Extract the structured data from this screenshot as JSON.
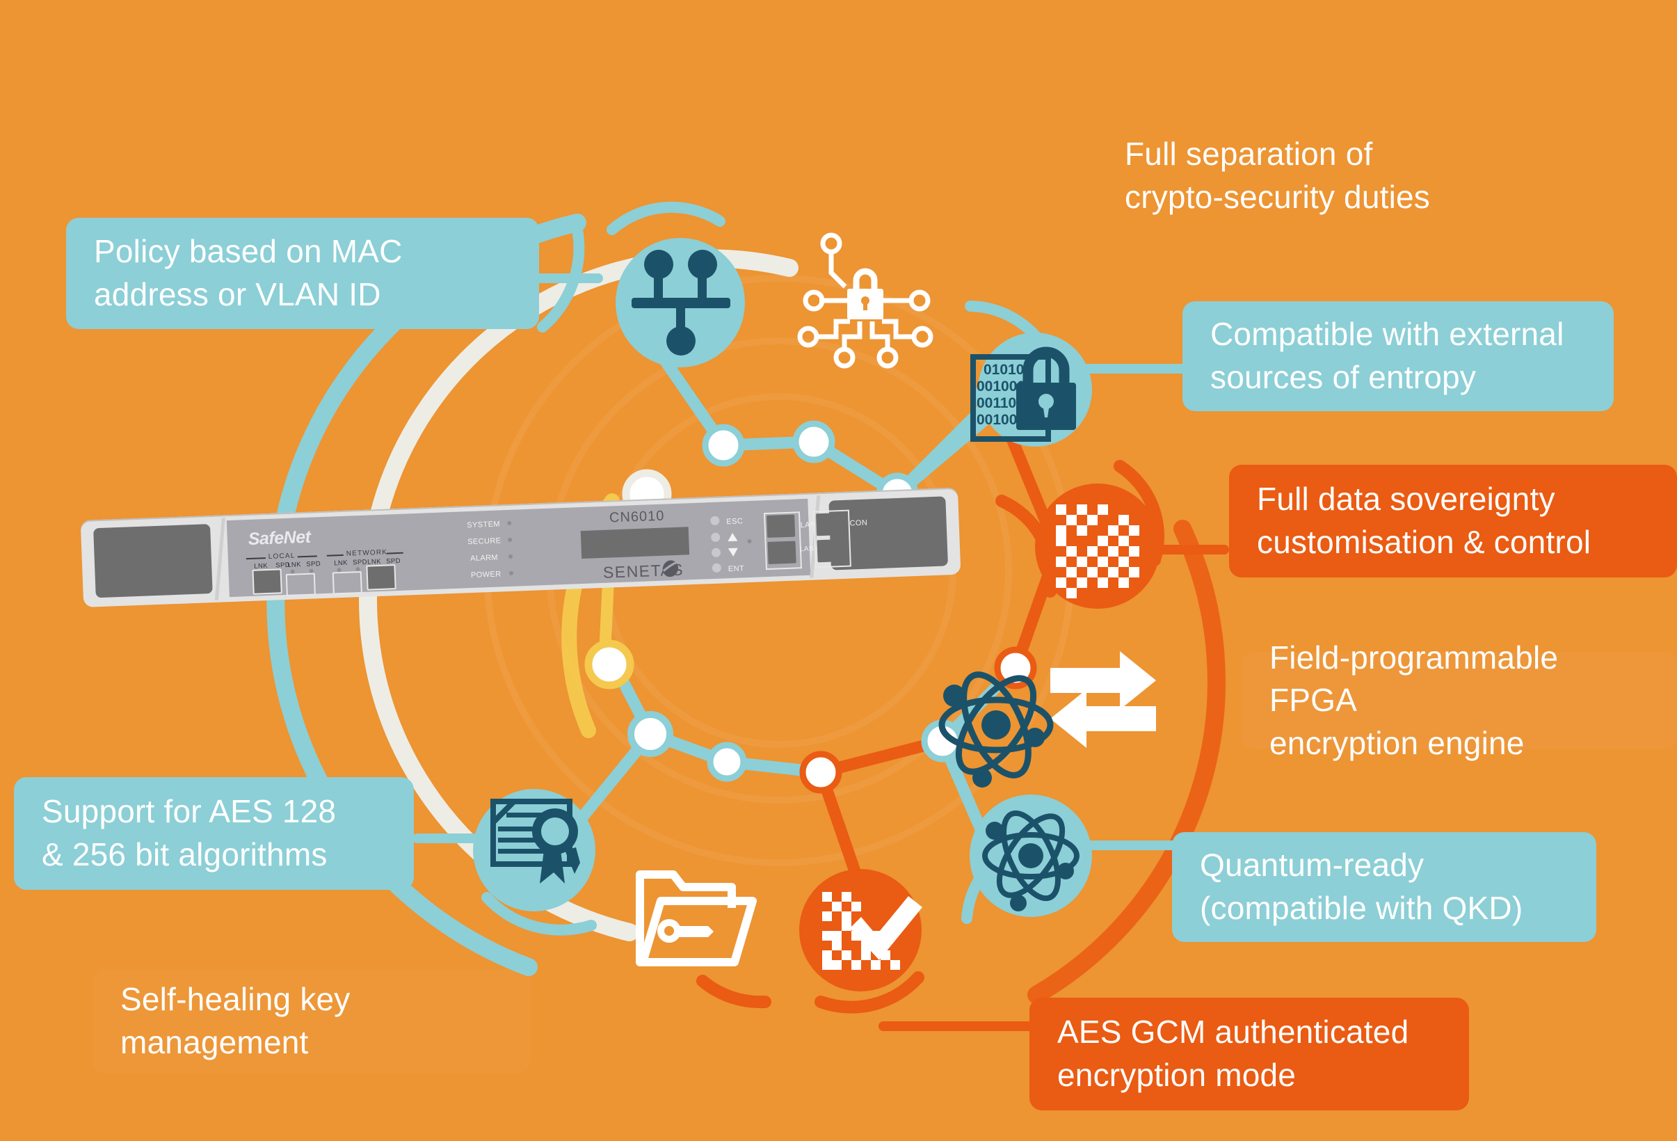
{
  "page": {
    "background_color": "#ED9433",
    "title": "Senetas CN6010 encryptor capabilities infographic"
  },
  "palette": {
    "background_orange": "#ED9433",
    "teal": "#8CCFD6",
    "dark_teal": "#1B5269",
    "deep_orange": "#EA5B13",
    "white": "#FFFFFF",
    "off_white": "#EDEDE5",
    "yellow": "#F4C94E",
    "chassis_light": "#E3E3E3",
    "chassis_face": "#A9A8AE",
    "chassis_dark": "#6E6E6E"
  },
  "callouts": [
    {
      "id": "policy-mac-vlan",
      "text": "Policy based on MAC\naddress or VLAN ID",
      "style": "teal"
    },
    {
      "id": "full-separation",
      "text": "Full separation of\ncrypto-security duties",
      "style": "plain"
    },
    {
      "id": "external-entropy",
      "text": "Compatible with external\nsources of entropy",
      "style": "teal"
    },
    {
      "id": "data-sovereignty",
      "text": "Full data sovereignty\ncustomisation & control",
      "style": "orange"
    },
    {
      "id": "fpga-engine",
      "text": "Field-programmable FPGA\nencryption engine",
      "style": "plain"
    },
    {
      "id": "aes-algorithms",
      "text": "Support for AES 128\n& 256 bit algorithms",
      "style": "teal"
    },
    {
      "id": "quantum-ready",
      "text": "Quantum-ready\n(compatible with QKD)",
      "style": "teal"
    },
    {
      "id": "self-healing-keys",
      "text": "Self-healing key\nmanagement",
      "style": "plain"
    },
    {
      "id": "aes-gcm",
      "text": "AES GCM authenticated\nencryption mode",
      "style": "orange"
    }
  ],
  "device": {
    "brand": "SafeNet",
    "model": "CN6010",
    "manufacturer": "SENETAS",
    "status_leds": [
      "SYSTEM",
      "SECURE",
      "ALARM",
      "POWER"
    ],
    "port_groups": [
      {
        "name": "LOCAL",
        "indicators": [
          "LNK",
          "SPD",
          "LNK",
          "SPD"
        ]
      },
      {
        "name": "NETWORK",
        "indicators": [
          "LNK",
          "SPD",
          "LNK",
          "SPD"
        ]
      }
    ],
    "keypad": [
      "ESC",
      "UP",
      "DOWN",
      "ENT"
    ],
    "rear_ports": [
      "LAN",
      "LAN (AUX)",
      "CON"
    ]
  },
  "icons": [
    {
      "id": "network-hub",
      "name": "network-hub-icon",
      "circle": "teal",
      "glyph": "dark"
    },
    {
      "id": "circuit-lock",
      "name": "circuit-lock-icon",
      "circle": "none",
      "glyph": "white"
    },
    {
      "id": "binary-lock",
      "name": "binary-lock-icon",
      "circle": "teal",
      "glyph": "dark",
      "binary_rows": [
        "010100",
        "001000",
        "001100",
        "001000"
      ]
    },
    {
      "id": "data-matrix",
      "name": "data-matrix-icon",
      "circle": "orange",
      "glyph": "white"
    },
    {
      "id": "transfer-arrows",
      "name": "transfer-arrows-icon",
      "circle": "none",
      "glyph": "white"
    },
    {
      "id": "atom-small",
      "name": "atom-icon",
      "circle": "none",
      "glyph": "dark"
    },
    {
      "id": "atom-large",
      "name": "atom-icon",
      "circle": "teal",
      "glyph": "dark"
    },
    {
      "id": "certificate",
      "name": "certificate-seal-icon",
      "circle": "teal",
      "glyph": "dark"
    },
    {
      "id": "folder-key",
      "name": "folder-key-icon",
      "circle": "none",
      "glyph": "white"
    },
    {
      "id": "data-matrix-check",
      "name": "data-matrix-check-icon",
      "circle": "orange",
      "glyph": "white"
    }
  ]
}
